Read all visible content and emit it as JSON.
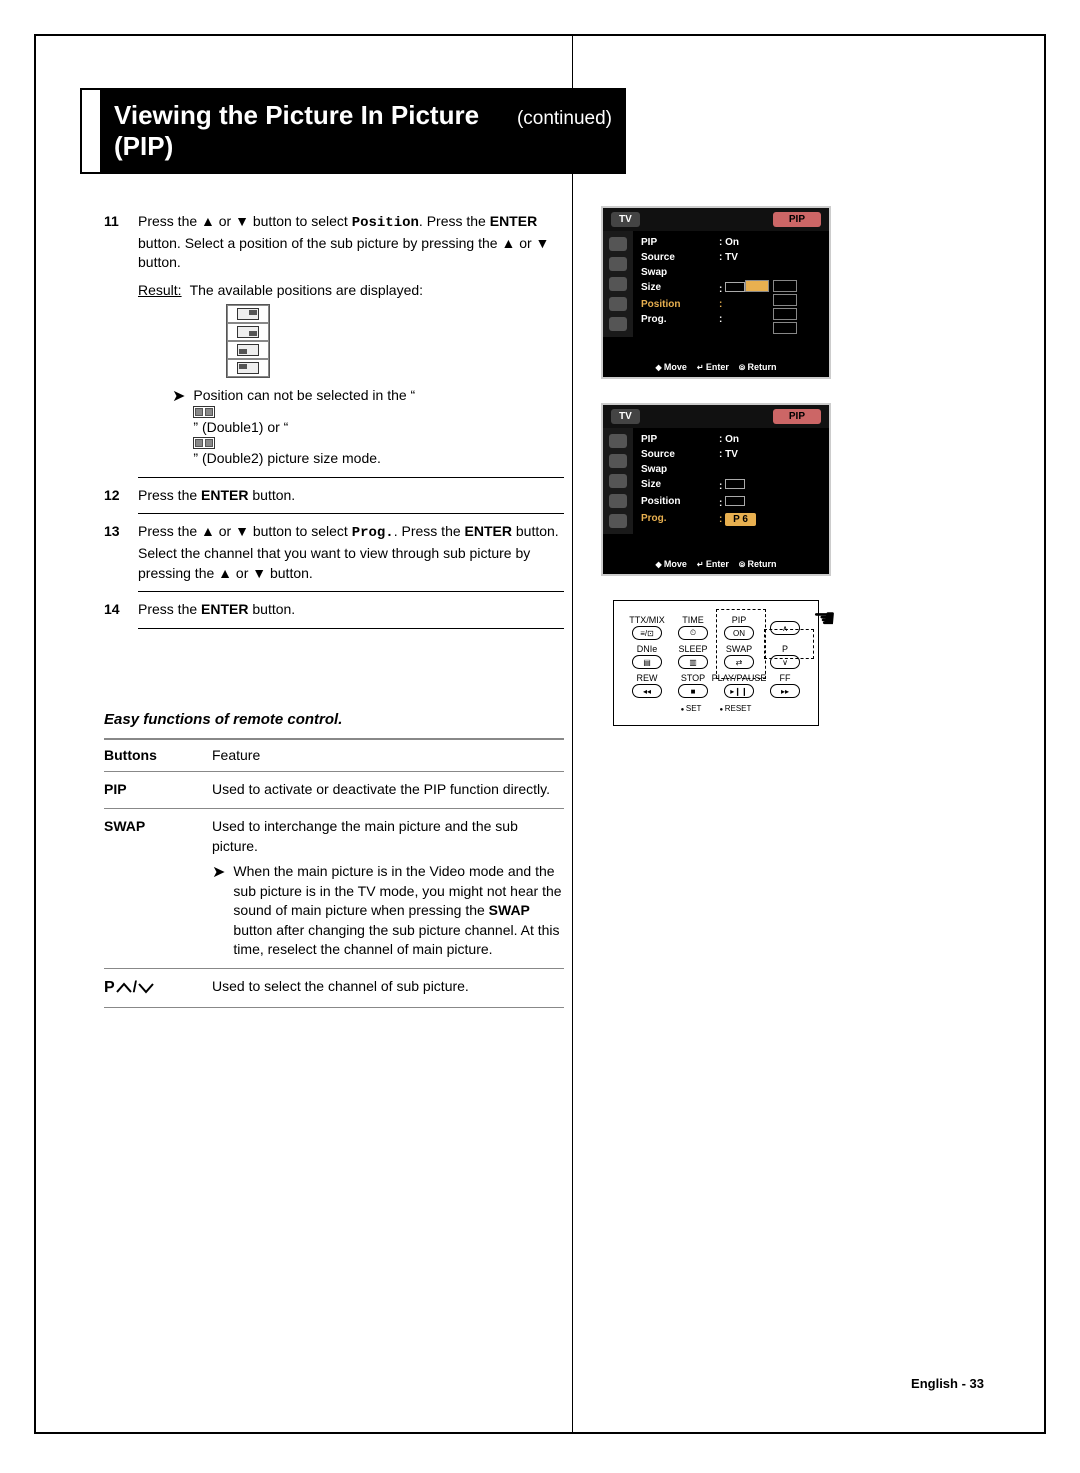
{
  "title": "Viewing the Picture In Picture (PIP)",
  "title_cont": "(continued)",
  "steps": {
    "s11": {
      "num": "11",
      "text_a": "Press the ▲ or ▼ button to select ",
      "kw": "Position",
      "text_b": ". Press the ",
      "kw2": "ENTER",
      "text_c": " button. Select a position of the sub picture by pressing the ▲ or ▼ button.",
      "result_lbl": "Result:",
      "result_txt": "The available positions are displayed:",
      "note": "Position can not be selected in the “   ” (Double1) or “   ” (Double2) picture size mode."
    },
    "s12": {
      "num": "12",
      "text_a": "Press the ",
      "kw": "ENTER",
      "text_b": " button."
    },
    "s13": {
      "num": "13",
      "text_a": "Press the ▲ or ▼ button to select ",
      "kw": "Prog.",
      "text_b": ". Press the ",
      "kw2": "ENTER",
      "text_c": " button. Select the channel that you want to view through sub picture by pressing the ▲ or ▼ button."
    },
    "s14": {
      "num": "14",
      "text_a": "Press the ",
      "kw": "ENTER",
      "text_b": " button."
    }
  },
  "easy": {
    "heading": "Easy functions of remote control.",
    "col1": "Buttons",
    "col2": "Feature",
    "r1": {
      "btn": "PIP",
      "feat": "Used to activate or deactivate the PIP function directly."
    },
    "r2": {
      "btn": "SWAP",
      "feat": "Used to interchange the main picture and the sub picture.",
      "note": "When the main picture is in the Video mode and the sub picture is in the TV mode, you might not hear the sound of main picture when pressing the ",
      "note_kw": "SWAP",
      "note_b": " button after changing the sub picture channel. At this time, reselect the channel of main picture."
    },
    "r3": {
      "btn": "P   /",
      "feat": "Used to select the channel of sub picture."
    }
  },
  "osd1": {
    "tv": "TV",
    "tab": "PIP",
    "rows": {
      "pip_k": "PIP",
      "pip_v": ": On",
      "src_k": "Source",
      "src_v": ": TV",
      "swap_k": "Swap",
      "size_k": "Size",
      "size_v": ":",
      "pos_k": "Position",
      "pos_v": ":",
      "prog_k": "Prog.",
      "prog_v": ":"
    },
    "foot": {
      "move": "Move",
      "enter": "Enter",
      "ret": "Return"
    }
  },
  "osd2": {
    "tv": "TV",
    "tab": "PIP",
    "rows": {
      "pip_k": "PIP",
      "pip_v": ": On",
      "src_k": "Source",
      "src_v": ": TV",
      "swap_k": "Swap",
      "size_k": "Size",
      "size_v": ":",
      "pos_k": "Position",
      "pos_v": ":",
      "prog_k": "Prog.",
      "prog_v": ":",
      "prog_sel": "P 6"
    },
    "foot": {
      "move": "Move",
      "enter": "Enter",
      "ret": "Return"
    }
  },
  "remote": {
    "r1": {
      "a": "TTX/MIX",
      "b": "TIME",
      "c": "PIP",
      "d": "",
      "c_btn": "ON"
    },
    "r2": {
      "a": "DNIe",
      "b": "SLEEP",
      "c": "SWAP",
      "d": "P"
    },
    "r3": {
      "a": "REW",
      "b": "STOP",
      "c": "PLAY/PAUSE",
      "d": "FF"
    },
    "set": "SET",
    "reset": "RESET"
  },
  "footer": "English - 33"
}
